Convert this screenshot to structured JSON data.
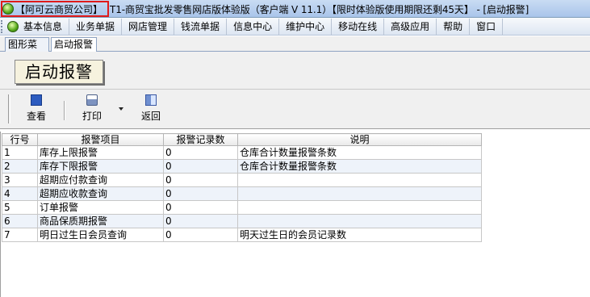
{
  "window": {
    "company_label": "【阿可云商贸公司】",
    "title": "T1-商贸宝批发零售网店版体验版（客户端 V 11.1）【限时体验版使用期限还剩45天】 - [启动报警]"
  },
  "menu": {
    "items": [
      "基本信息",
      "业务单据",
      "网店管理",
      "钱流单据",
      "信息中心",
      "维护中心",
      "移动在线",
      "高级应用",
      "帮助",
      "窗口"
    ]
  },
  "tabs": [
    "图形菜单",
    "启动报警"
  ],
  "active_tab": "启动报警",
  "page": {
    "heading": "启动报警"
  },
  "toolbar": {
    "view_label": "查看",
    "print_label": "打印",
    "back_label": "返回"
  },
  "grid": {
    "columns": [
      "行号",
      "报警项目",
      "报警记录数",
      "说明"
    ],
    "rows": [
      {
        "no": "1",
        "item": "库存上限报警",
        "count": "0",
        "desc": "仓库合计数量报警条数"
      },
      {
        "no": "2",
        "item": "库存下限报警",
        "count": "0",
        "desc": "仓库合计数量报警条数"
      },
      {
        "no": "3",
        "item": "超期应付款查询",
        "count": "0",
        "desc": ""
      },
      {
        "no": "4",
        "item": "超期应收款查询",
        "count": "0",
        "desc": ""
      },
      {
        "no": "5",
        "item": "订单报警",
        "count": "0",
        "desc": ""
      },
      {
        "no": "6",
        "item": "商品保质期报警",
        "count": "0",
        "desc": ""
      },
      {
        "no": "7",
        "item": "明日过生日会员查询",
        "count": "0",
        "desc": "明天过生日的会员记录数"
      }
    ]
  }
}
